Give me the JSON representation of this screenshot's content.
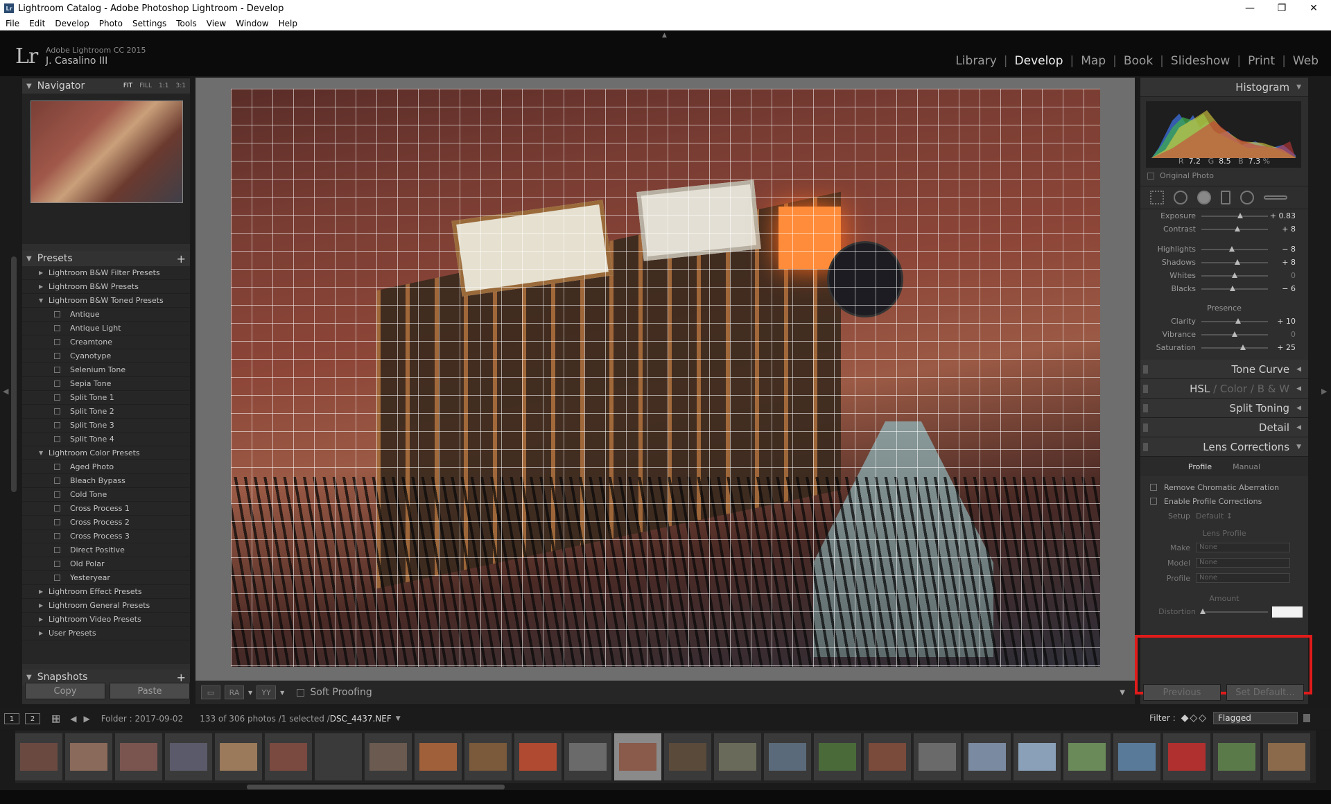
{
  "window": {
    "title": "Lightroom Catalog - Adobe Photoshop Lightroom - Develop",
    "app_icon": "Lr"
  },
  "menu": [
    "File",
    "Edit",
    "Develop",
    "Photo",
    "Settings",
    "Tools",
    "View",
    "Window",
    "Help"
  ],
  "identity": {
    "logo": "Lr",
    "version": "Adobe Lightroom CC 2015",
    "user": "J. Casalino III"
  },
  "modules": [
    "Library",
    "Develop",
    "Map",
    "Book",
    "Slideshow",
    "Print",
    "Web"
  ],
  "active_module": "Develop",
  "navigator": {
    "title": "Navigator",
    "options": [
      "FIT",
      "FILL",
      "1:1",
      "3:1"
    ]
  },
  "presets": {
    "title": "Presets",
    "items": [
      {
        "label": "Lightroom B&W Filter Presets",
        "type": "folder",
        "open": false
      },
      {
        "label": "Lightroom B&W Presets",
        "type": "folder",
        "open": false
      },
      {
        "label": "Lightroom B&W Toned Presets",
        "type": "folder",
        "open": true
      },
      {
        "label": "Antique",
        "type": "preset"
      },
      {
        "label": "Antique Light",
        "type": "preset"
      },
      {
        "label": "Creamtone",
        "type": "preset"
      },
      {
        "label": "Cyanotype",
        "type": "preset"
      },
      {
        "label": "Selenium Tone",
        "type": "preset"
      },
      {
        "label": "Sepia Tone",
        "type": "preset"
      },
      {
        "label": "Split Tone 1",
        "type": "preset"
      },
      {
        "label": "Split Tone 2",
        "type": "preset"
      },
      {
        "label": "Split Tone 3",
        "type": "preset"
      },
      {
        "label": "Split Tone 4",
        "type": "preset"
      },
      {
        "label": "Lightroom Color Presets",
        "type": "folder",
        "open": true
      },
      {
        "label": "Aged Photo",
        "type": "preset"
      },
      {
        "label": "Bleach Bypass",
        "type": "preset"
      },
      {
        "label": "Cold Tone",
        "type": "preset"
      },
      {
        "label": "Cross Process 1",
        "type": "preset"
      },
      {
        "label": "Cross Process 2",
        "type": "preset"
      },
      {
        "label": "Cross Process 3",
        "type": "preset"
      },
      {
        "label": "Direct Positive",
        "type": "preset"
      },
      {
        "label": "Old Polar",
        "type": "preset"
      },
      {
        "label": "Yesteryear",
        "type": "preset"
      },
      {
        "label": "Lightroom Effect Presets",
        "type": "folder",
        "open": false
      },
      {
        "label": "Lightroom General Presets",
        "type": "folder",
        "open": false
      },
      {
        "label": "Lightroom Video Presets",
        "type": "folder",
        "open": false
      },
      {
        "label": "User Presets",
        "type": "folder",
        "open": false
      }
    ]
  },
  "snapshots": {
    "title": "Snapshots"
  },
  "left_buttons": {
    "copy": "Copy",
    "paste": "Paste"
  },
  "toolbar": {
    "soft_proofing": "Soft Proofing"
  },
  "histogram": {
    "title": "Histogram",
    "r_label": "R",
    "r": "7.2",
    "g_label": "G",
    "g": "8.5",
    "b_label": "B",
    "b": "7.3",
    "pct": "%",
    "original_photo": "Original Photo"
  },
  "basic": {
    "sliders1": [
      {
        "label": "Exposure",
        "value": "+ 0.83",
        "pos": 0.58
      },
      {
        "label": "Contrast",
        "value": "+ 8",
        "pos": 0.54
      }
    ],
    "sliders2": [
      {
        "label": "Highlights",
        "value": "− 8",
        "pos": 0.46
      },
      {
        "label": "Shadows",
        "value": "+ 8",
        "pos": 0.54
      },
      {
        "label": "Whites",
        "value": "0",
        "pos": 0.5,
        "dim": true
      },
      {
        "label": "Blacks",
        "value": "− 6",
        "pos": 0.47
      }
    ],
    "presence_label": "Presence",
    "sliders3": [
      {
        "label": "Clarity",
        "value": "+ 10",
        "pos": 0.55
      },
      {
        "label": "Vibrance",
        "value": "0",
        "pos": 0.5,
        "dim": true
      },
      {
        "label": "Saturation",
        "value": "+ 25",
        "pos": 0.62
      }
    ]
  },
  "panels": {
    "tone_curve": "Tone Curve",
    "hsl": "HSL",
    "hsl_sep": "/",
    "color": "Color",
    "bw": "B & W",
    "split_toning": "Split Toning",
    "detail": "Detail",
    "lens_corrections": "Lens Corrections"
  },
  "lens": {
    "tabs": [
      "Profile",
      "Manual"
    ],
    "remove_ca": "Remove Chromatic Aberration",
    "enable_profile": "Enable Profile Corrections",
    "setup_label": "Setup",
    "setup_value": "Default ↕",
    "lens_profile": "Lens Profile",
    "make_label": "Make",
    "make_value": "None",
    "model_label": "Model",
    "model_value": "None",
    "profile_label": "Profile",
    "profile_value": "None",
    "amount": "Amount",
    "distortion_label": "Distortion"
  },
  "right_buttons": {
    "previous": "Previous",
    "set_default": "Set Default..."
  },
  "filmbar": {
    "page1": "1",
    "page2": "2",
    "folder": "Folder : 2017-09-02",
    "count": "133 of 306 photos /1 selected /",
    "filename": "DSC_4437.NEF",
    "filter_label": "Filter :",
    "filter_value": "Flagged"
  },
  "colors": {
    "accent_highlight": "#e01b1b",
    "panel_bg": "#2e2e2e"
  }
}
